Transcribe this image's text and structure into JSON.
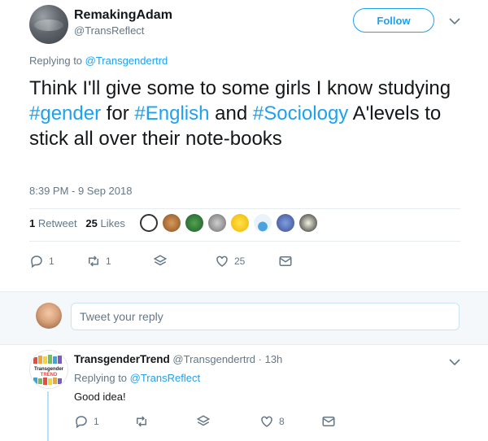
{
  "tweet": {
    "author_name": "RemakingAdam",
    "author_handle": "@TransReflect",
    "follow_label": "Follow",
    "replying_prefix": "Replying to ",
    "replying_to": "@Transgendertrd",
    "text_parts": [
      {
        "t": "Think I'll give some to some girls I know studying ",
        "link": false
      },
      {
        "t": "#gender",
        "link": true
      },
      {
        "t": " for ",
        "link": false
      },
      {
        "t": "#English",
        "link": true
      },
      {
        "t": " and ",
        "link": false
      },
      {
        "t": "#Sociology",
        "link": true
      },
      {
        "t": " A'levels to stick all over their note-books",
        "link": false
      }
    ],
    "timestamp": "8:39 PM - 9 Sep 2018",
    "retweets_count": "1",
    "retweets_label": "Retweet",
    "likes_count": "25",
    "likes_label": "Likes",
    "actions": {
      "reply_count": "1",
      "retweet_count": "1",
      "like_count": "25"
    }
  },
  "reply_box": {
    "placeholder": "Tweet your reply"
  },
  "reply_tweet": {
    "author_name": "TransgenderTrend",
    "author_handle": "@Transgendertrd",
    "time_ago": "· 13h",
    "avatar_text": "Transgender TREND",
    "replying_prefix": "Replying to ",
    "replying_to": "@TransReflect",
    "text": "Good idea!",
    "actions": {
      "reply_count": "1",
      "like_count": "8"
    }
  },
  "colors": {
    "accent": "#1da1f2",
    "muted": "#657786",
    "text": "#14171a"
  }
}
